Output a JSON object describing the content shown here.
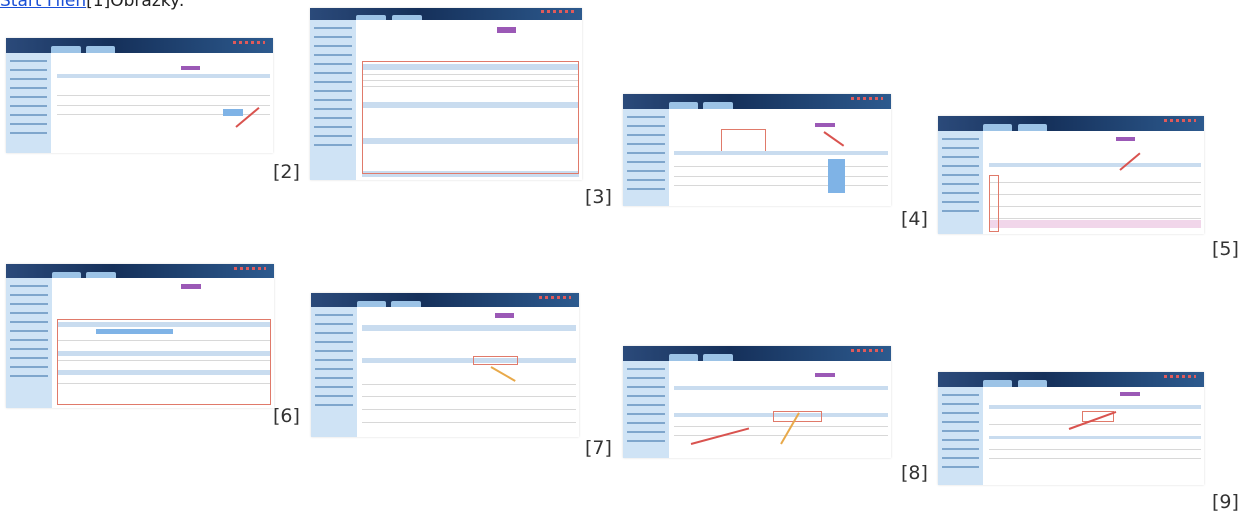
{
  "header": {
    "link_text": "Start Filen",
    "rest_text": "[1]Obrázky:"
  },
  "figures": [
    {
      "label": "[2]"
    },
    {
      "label": "[3]"
    },
    {
      "label": "[4]"
    },
    {
      "label": "[5]"
    },
    {
      "label": "[6]"
    },
    {
      "label": "[7]"
    },
    {
      "label": "[8]"
    },
    {
      "label": "[9]"
    }
  ],
  "colors": {
    "link": "#1a4fd6",
    "header_bar": "#15305a",
    "sidebar": "#cfe3f5",
    "accent_button": "#9b59b6",
    "highlight_box": "#e07a6a"
  }
}
